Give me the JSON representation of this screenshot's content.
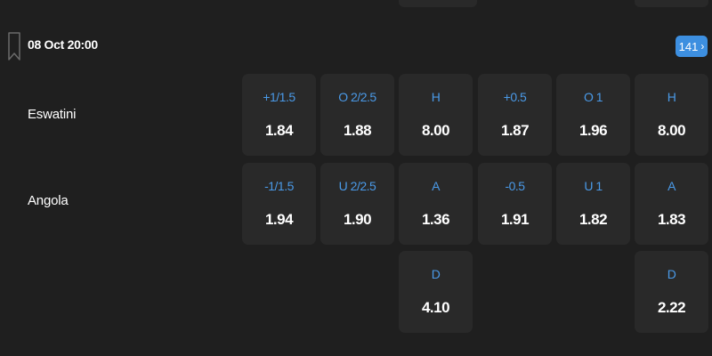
{
  "match": {
    "time": "08 Oct 20:00",
    "more_count": "141",
    "more_chevron": "›",
    "home_team": "Eswatini",
    "away_team": "Angola"
  },
  "markets": {
    "handicap": {
      "home": {
        "label": "+1/1.5",
        "odds": "1.84"
      },
      "away": {
        "label": "-1/1.5",
        "odds": "1.94"
      }
    },
    "total": {
      "over": {
        "label": "O 2/2.5",
        "odds": "1.88"
      },
      "under": {
        "label": "U 2/2.5",
        "odds": "1.90"
      }
    },
    "result": {
      "home": {
        "label": "H",
        "odds": "8.00"
      },
      "away": {
        "label": "A",
        "odds": "1.36"
      },
      "draw": {
        "label": "D",
        "odds": "4.10"
      }
    },
    "handicap_half": {
      "home": {
        "label": "+0.5",
        "odds": "1.87"
      },
      "away": {
        "label": "-0.5",
        "odds": "1.91"
      }
    },
    "total_half": {
      "over": {
        "label": "O 1",
        "odds": "1.96"
      },
      "under": {
        "label": "U 1",
        "odds": "1.82"
      }
    },
    "result_half": {
      "home": {
        "label": "H",
        "odds": "8.00"
      },
      "away": {
        "label": "A",
        "odds": "1.83"
      },
      "draw": {
        "label": "D",
        "odds": "2.22"
      }
    }
  },
  "icons": {
    "bookmark": "bookmark-icon",
    "chevron": "chevron-right-icon"
  },
  "colors": {
    "background": "#1f1f1f",
    "cell": "#292929",
    "accent": "#4a9ae8",
    "button": "#3d8fe0",
    "text": "#ffffff"
  }
}
